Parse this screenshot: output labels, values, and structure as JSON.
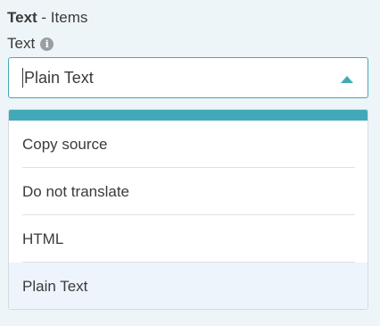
{
  "section": {
    "title_bold": "Text",
    "title_rest": " - Items"
  },
  "field": {
    "label": "Text",
    "info_icon_glyph": "i",
    "info_icon": "info-icon"
  },
  "select": {
    "value": "Plain Text",
    "expanded": true,
    "chevron_icon": "chevron-up-icon",
    "accent_color": "#43a9b8"
  },
  "dropdown": {
    "options": [
      {
        "label": "Copy source"
      },
      {
        "label": "Do not translate"
      },
      {
        "label": "HTML"
      },
      {
        "label": "Plain Text",
        "selected": true
      }
    ],
    "selected_bg": "#edf4fb"
  }
}
